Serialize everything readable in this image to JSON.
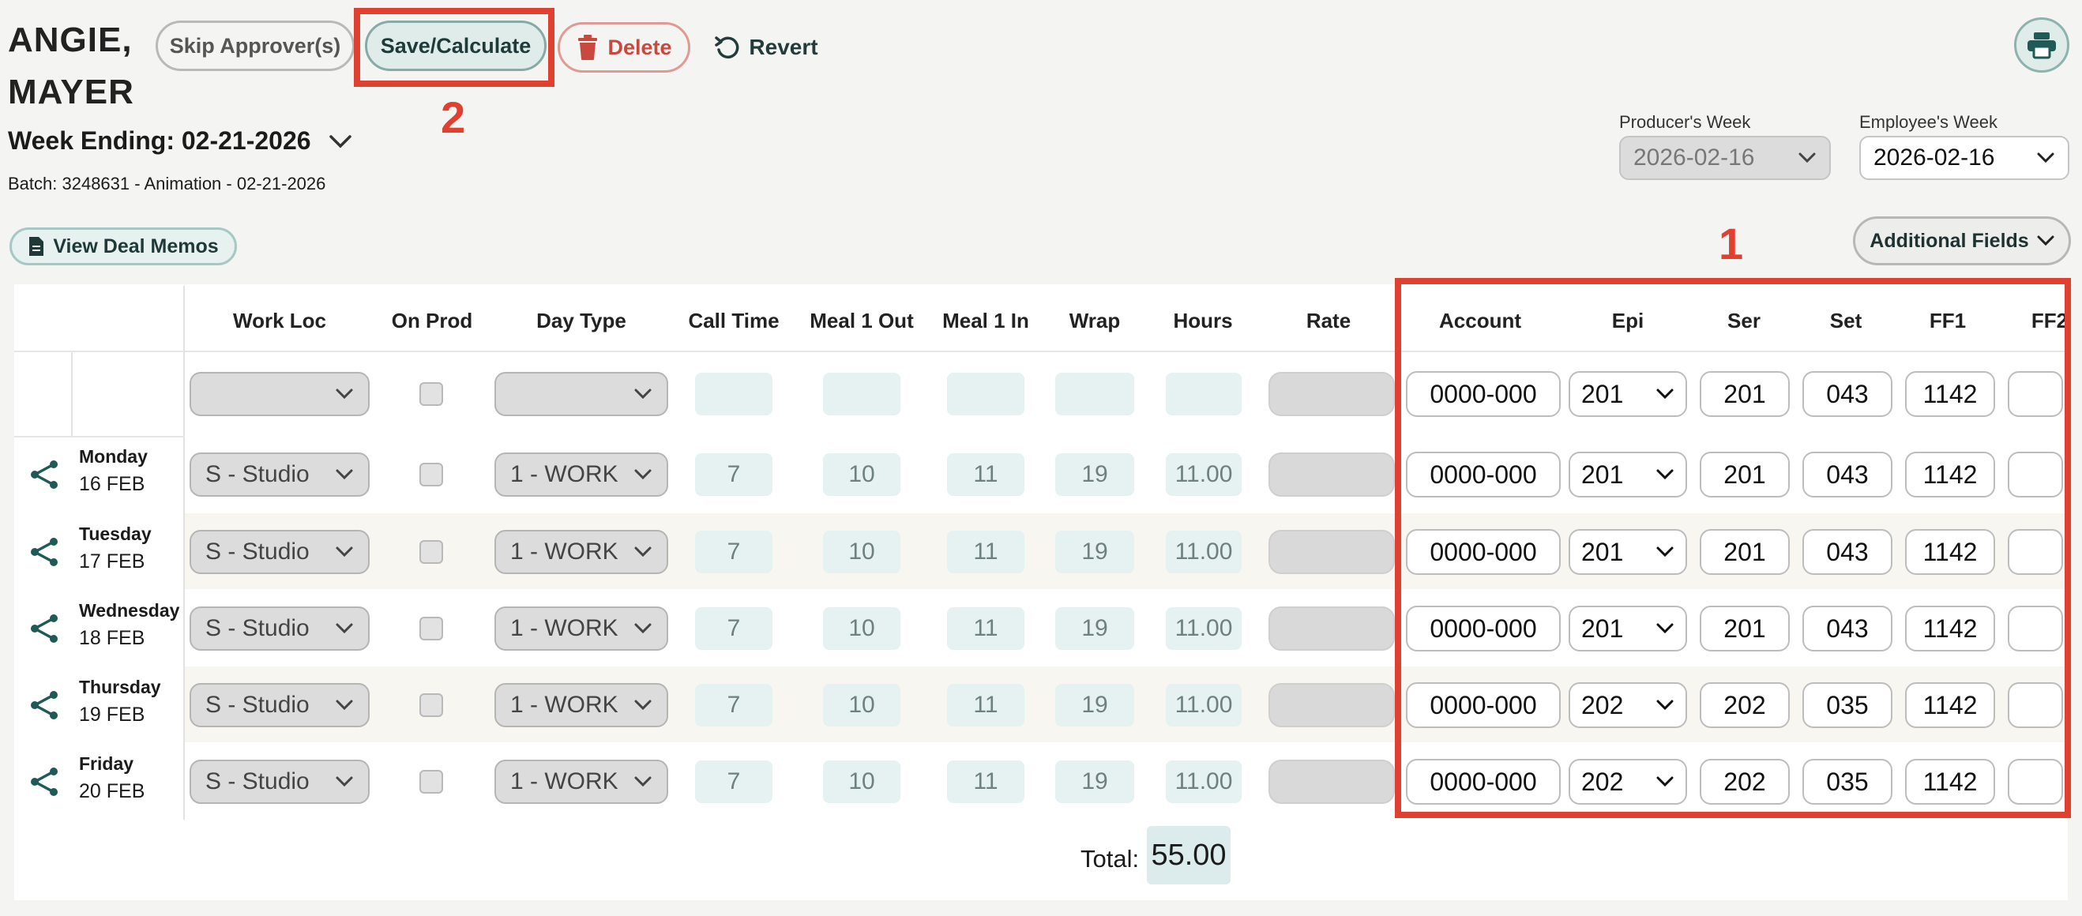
{
  "employee": {
    "last_name": "ANGIE,",
    "first_name": "MAYER"
  },
  "toolbar": {
    "skip_label": "Skip Approver(s)",
    "save_label": "Save/Calculate",
    "delete_label": "Delete",
    "revert_label": "Revert"
  },
  "annotations": {
    "box1_number": "1",
    "box2_number": "2"
  },
  "week_ending_label": "Week Ending: 02-21-2026",
  "batch_text": "Batch: 3248631 - Animation - 02-21-2026",
  "view_deal_memos_label": "View Deal Memos",
  "producers_week": {
    "label": "Producer's Week",
    "value": "2026-02-16"
  },
  "employees_week": {
    "label": "Employee's Week",
    "value": "2026-02-16"
  },
  "additional_fields_label": "Additional Fields",
  "columns": {
    "work_loc": "Work Loc",
    "on_prod": "On Prod",
    "day_type": "Day Type",
    "call_time": "Call Time",
    "meal1_out": "Meal 1 Out",
    "meal1_in": "Meal 1 In",
    "wrap": "Wrap",
    "hours": "Hours",
    "rate": "Rate",
    "account": "Account",
    "epi": "Epi",
    "ser": "Ser",
    "set": "Set",
    "ff1": "FF1",
    "ff2": "FF2"
  },
  "default_row": {
    "account": "0000-000",
    "epi": "201",
    "ser": "201",
    "set": "043",
    "ff1": "1142"
  },
  "days": [
    {
      "day": "Monday",
      "date": "16 FEB",
      "work_loc": "S - Studio",
      "day_type": "1 - WORK",
      "call": "7",
      "meal_out": "10",
      "meal_in": "11",
      "wrap": "19",
      "hours": "11.00",
      "account": "0000-000",
      "epi": "201",
      "ser": "201",
      "set": "043",
      "ff1": "1142"
    },
    {
      "day": "Tuesday",
      "date": "17 FEB",
      "work_loc": "S - Studio",
      "day_type": "1 - WORK",
      "call": "7",
      "meal_out": "10",
      "meal_in": "11",
      "wrap": "19",
      "hours": "11.00",
      "account": "0000-000",
      "epi": "201",
      "ser": "201",
      "set": "043",
      "ff1": "1142"
    },
    {
      "day": "Wednesday",
      "date": "18 FEB",
      "work_loc": "S - Studio",
      "day_type": "1 - WORK",
      "call": "7",
      "meal_out": "10",
      "meal_in": "11",
      "wrap": "19",
      "hours": "11.00",
      "account": "0000-000",
      "epi": "201",
      "ser": "201",
      "set": "043",
      "ff1": "1142"
    },
    {
      "day": "Thursday",
      "date": "19 FEB",
      "work_loc": "S - Studio",
      "day_type": "1 - WORK",
      "call": "7",
      "meal_out": "10",
      "meal_in": "11",
      "wrap": "19",
      "hours": "11.00",
      "account": "0000-000",
      "epi": "202",
      "ser": "202",
      "set": "035",
      "ff1": "1142"
    },
    {
      "day": "Friday",
      "date": "20 FEB",
      "work_loc": "S - Studio",
      "day_type": "1 - WORK",
      "call": "7",
      "meal_out": "10",
      "meal_in": "11",
      "wrap": "19",
      "hours": "11.00",
      "account": "0000-000",
      "epi": "202",
      "ser": "202",
      "set": "035",
      "ff1": "1142"
    }
  ],
  "total": {
    "label": "Total:",
    "value": "55.00"
  },
  "colors": {
    "accent_red": "#e0402f",
    "teal": "#1f5a57",
    "delete_red": "#c9483f"
  }
}
